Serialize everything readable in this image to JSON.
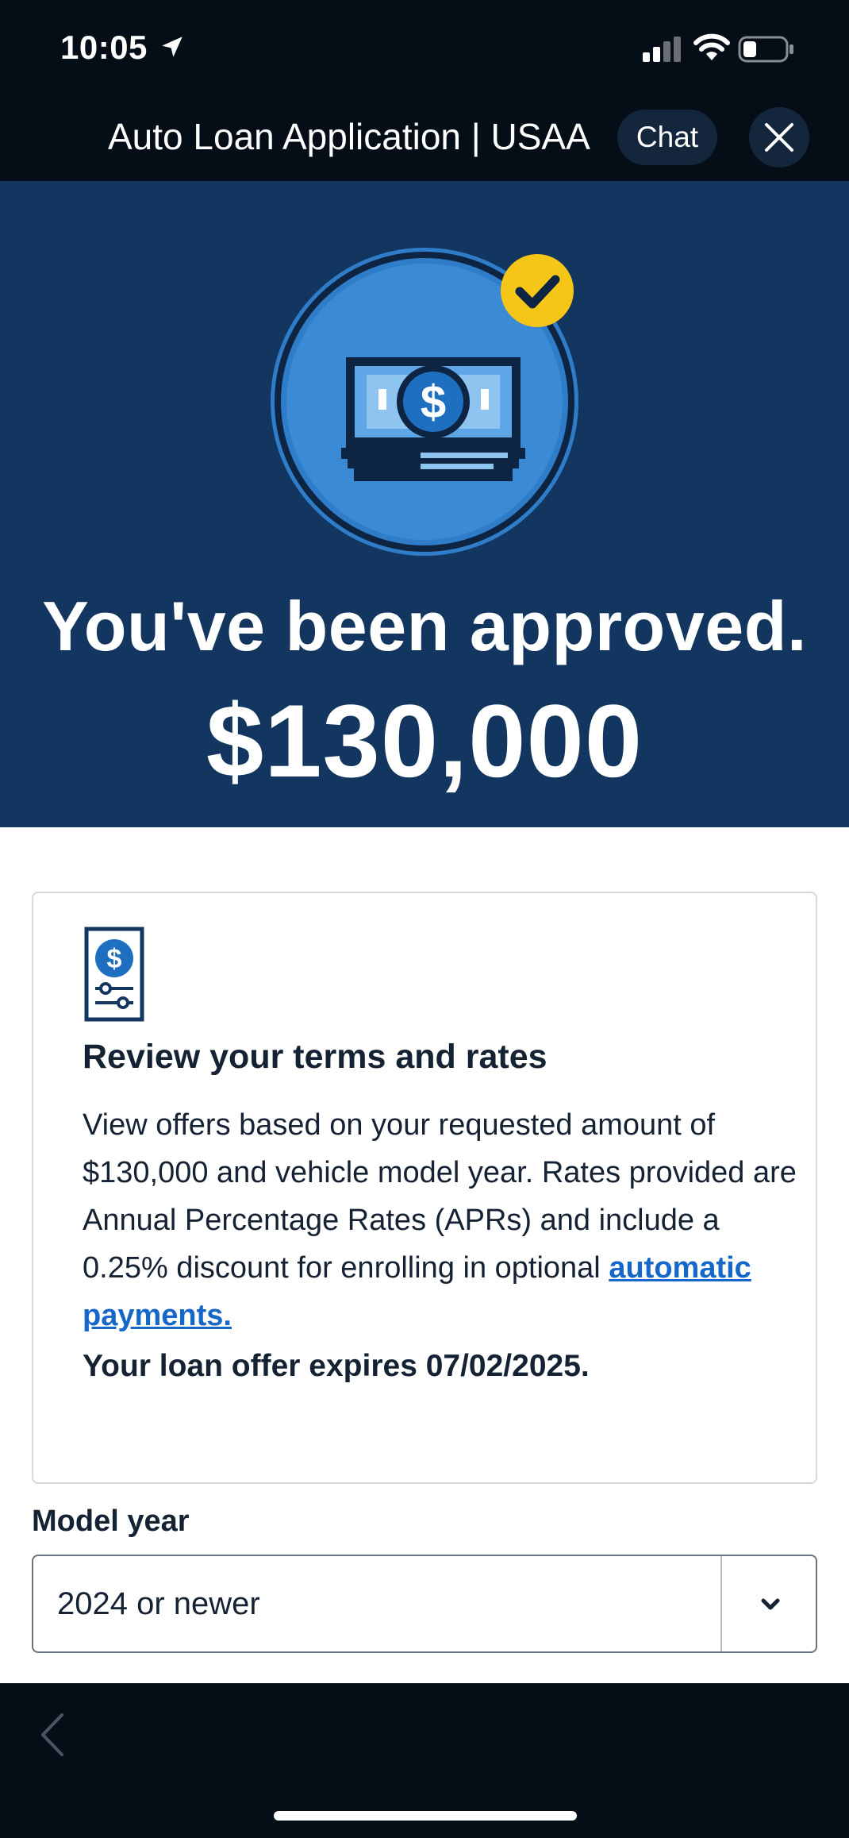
{
  "status_bar": {
    "time": "10:05",
    "icons": [
      "location-arrow-icon",
      "cellular-signal-icon",
      "wifi-icon",
      "battery-icon"
    ]
  },
  "header": {
    "title": "Auto Loan Application | USAA",
    "chat_label": "Chat",
    "close_icon": "close-icon"
  },
  "hero": {
    "heading": "You've been approved.",
    "amount": "$130,000",
    "icons": [
      "money-stack-icon",
      "checkmark-badge-icon"
    ]
  },
  "terms_card": {
    "title": "Review your terms and rates",
    "body_text": "View offers based on your requested amount of $130,000 and vehicle model year. Rates provided are Annual Percentage Rates (APRs) and include a 0.25% discount for enrolling in optional ",
    "link_text": "automatic payments.",
    "expiry_text": "Your loan offer expires 07/02/2025.",
    "icon": "document-dollar-icon"
  },
  "model_year": {
    "label": "Model year",
    "selected": "2024 or newer"
  },
  "bottom_bar": {
    "back_icon": "chevron-left-icon"
  },
  "colors": {
    "top_bar": "#050d17",
    "hero_background": "#12365f",
    "icon_blue": "#1f6fc0",
    "badge_yellow": "#f5c518",
    "link": "#1567c9",
    "text_dark": "#142233"
  }
}
